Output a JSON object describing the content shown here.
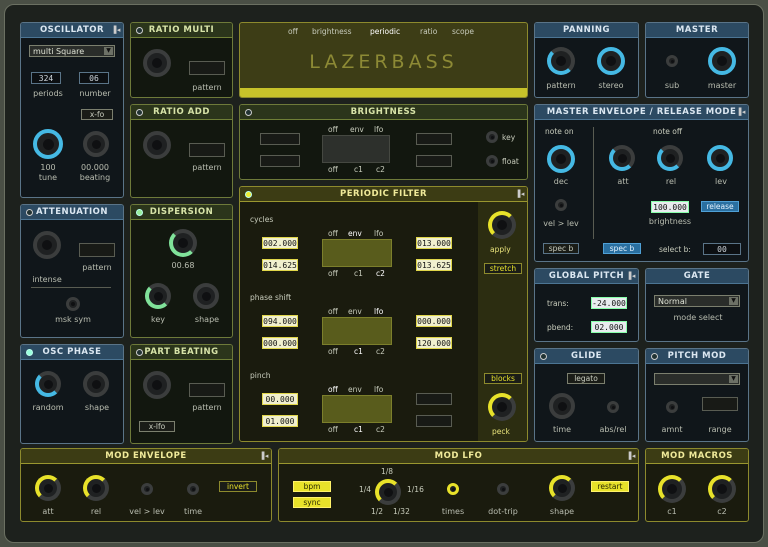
{
  "oscillator": {
    "title": "OSCILLATOR",
    "waveform": "multi Square",
    "periods_value": "324",
    "periods_label": "periods",
    "number_value": "06",
    "number_label": "number",
    "xfo": "x-fo",
    "tune_value": "100",
    "tune_label": "tune",
    "beating_value": "00.000",
    "beating_label": "beating"
  },
  "ratio_multi": {
    "title": "RATIO MULTI",
    "pattern": "pattern"
  },
  "ratio_add": {
    "title": "RATIO ADD",
    "pattern": "pattern"
  },
  "attenuation": {
    "title": "ATTENUATION",
    "intense": "intense",
    "pattern": "pattern",
    "msk_sym": "msk sym"
  },
  "dispersion": {
    "title": "DISPERSION",
    "value": "00.68",
    "key": "key",
    "shape": "shape"
  },
  "osc_phase": {
    "title": "OSC PHASE",
    "random": "random",
    "shape": "shape"
  },
  "part_beating": {
    "title": "PART BEATING",
    "pattern": "pattern",
    "xfo": "x-lfo"
  },
  "display": {
    "tabs": [
      "off",
      "brightness",
      "periodic",
      "ratio",
      "scope"
    ],
    "name": "LAZERBASS"
  },
  "brightness": {
    "title": "BRIGHTNESS",
    "mode": [
      "off",
      "env",
      "lfo"
    ],
    "src": [
      "off",
      "c1",
      "c2"
    ],
    "key": "key",
    "float": "float"
  },
  "periodic": {
    "title": "PERIODIC FILTER",
    "cycles": "cycles",
    "phase_shift": "phase shift",
    "pinch": "pinch",
    "apply": "apply",
    "stretch": "stretch",
    "blocks": "blocks",
    "peck": "peck",
    "mode": [
      "off",
      "env",
      "lfo"
    ],
    "src": [
      "off",
      "c1",
      "c2"
    ],
    "c_left1": "002.000",
    "c_left2": "014.625",
    "c_right1": "013.000",
    "c_right2": "013.625",
    "p_left1": "094.000",
    "p_left2": "000.000",
    "p_right1": "000.000",
    "p_right2": "120.000",
    "pi_left1": "00.000",
    "pi_left2": "01.000"
  },
  "panning": {
    "title": "PANNING",
    "pattern": "pattern",
    "stereo": "stereo"
  },
  "master": {
    "title": "MASTER",
    "sub": "sub",
    "master": "master"
  },
  "master_env": {
    "title": "MASTER ENVELOPE / RELEASE MODE",
    "note_on": "note on",
    "note_off": "note off",
    "dec": "dec",
    "vel_lev": "vel > lev",
    "att": "att",
    "rel": "rel",
    "lev": "lev",
    "brightness_val": "100.000",
    "brightness": "brightness",
    "release": "release",
    "spec_a": "spec b",
    "spec_b": "spec b",
    "select_b": "select b:",
    "select_val": "00"
  },
  "global_pitch": {
    "title": "GLOBAL PITCH",
    "trans": "trans:",
    "trans_val": "-24.000",
    "pbend": "pbend:",
    "pbend_val": "02.000"
  },
  "gate": {
    "title": "GATE",
    "mode": "Normal",
    "mode_label": "mode select"
  },
  "glide": {
    "title": "GLIDE",
    "legato": "legato",
    "time": "time",
    "abs_rel": "abs/rel"
  },
  "pitch_mod": {
    "title": "PITCH MOD",
    "amnt": "amnt",
    "range": "range"
  },
  "mod_env": {
    "title": "MOD ENVELOPE",
    "att": "att",
    "rel": "rel",
    "vel_lev": "vel > lev",
    "time": "time",
    "invert": "invert"
  },
  "mod_lfo": {
    "title": "MOD LFO",
    "bpm": "bpm",
    "sync": "sync",
    "d1": "1/8",
    "d2": "1/4",
    "d3": "1/16",
    "d4": "1/2",
    "d5": "1/32",
    "times": "times",
    "dot_trip": "dot-trip",
    "shape": "shape",
    "restart": "restart"
  },
  "mod_macros": {
    "title": "MOD MACROS",
    "c1": "c1",
    "c2": "c2"
  }
}
